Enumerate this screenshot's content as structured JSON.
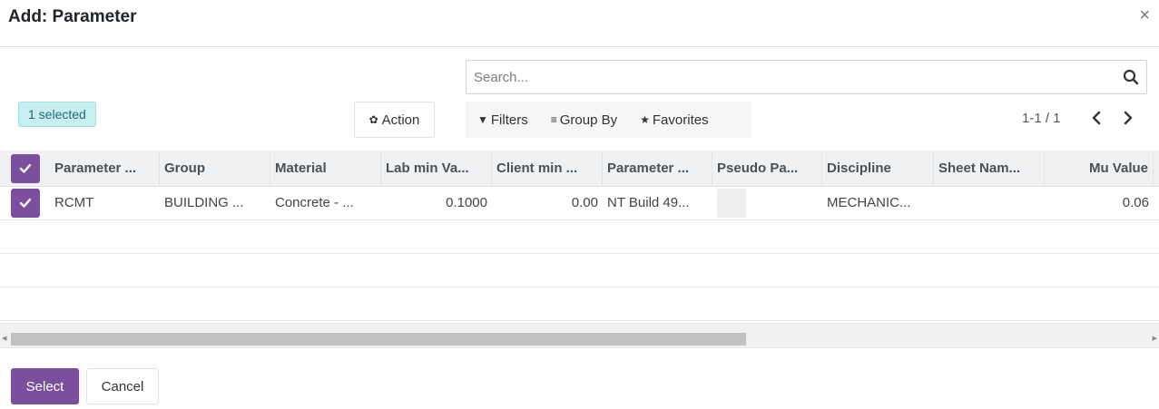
{
  "dialog": {
    "title": "Add: Parameter",
    "close_icon": "close-icon",
    "close_symbol": "×"
  },
  "search": {
    "placeholder": "Search...",
    "icon": "search-icon"
  },
  "selection": {
    "badge": "1 selected"
  },
  "toolbar": {
    "action_label": "Action",
    "action_icon": "gear-icon",
    "filters_label": "Filters",
    "filters_icon": "filter-icon",
    "group_by_label": "Group By",
    "group_by_icon": "list-icon",
    "favorites_label": "Favorites",
    "favorites_icon": "star-icon"
  },
  "pager": {
    "value": "1-1 / 1",
    "prev_icon": "chevron-left-icon",
    "next_icon": "chevron-right-icon"
  },
  "table": {
    "columns": [
      "Parameter ...",
      "Group",
      "Material",
      "Lab min Va...",
      "Client min ...",
      "Parameter ...",
      "Pseudo Pa...",
      "Discipline",
      "Sheet Nam...",
      "Mu Value"
    ],
    "rows": [
      {
        "selected": true,
        "cells": [
          "RCMT",
          "BUILDING ...",
          "Concrete - ...",
          "0.1000",
          "0.00",
          "NT Build 49...",
          "",
          "MECHANIC...",
          "",
          "0.06"
        ]
      }
    ]
  },
  "footer": {
    "select_label": "Select",
    "cancel_label": "Cancel"
  },
  "colors": {
    "primary": "#7c4f9e",
    "badge_bg": "#c8eff0",
    "header_bg": "#f0f1f2"
  }
}
